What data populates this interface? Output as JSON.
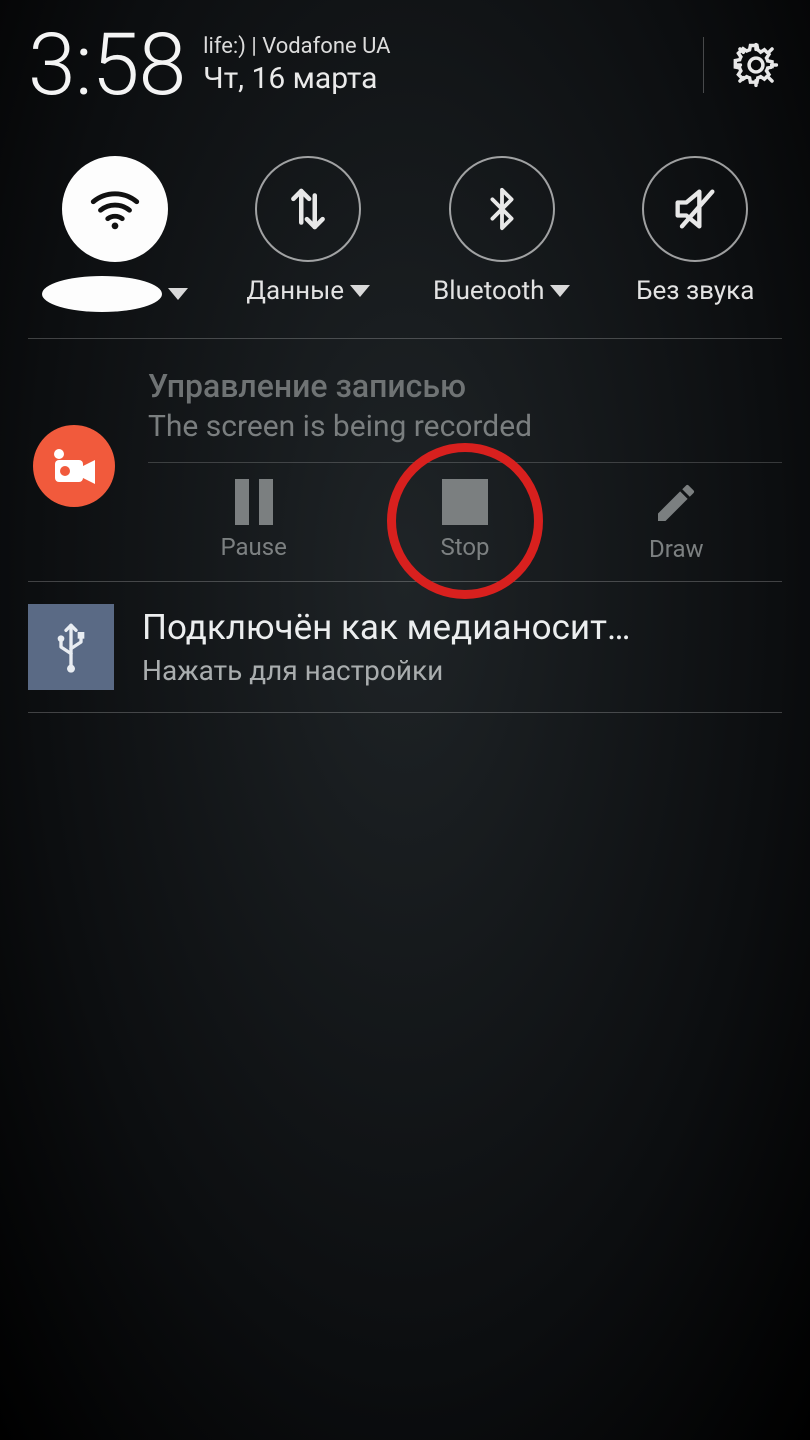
{
  "status": {
    "time": "3:58",
    "carrier": "life:) | Vodafone UA",
    "date": "Чт, 16 марта"
  },
  "quick_settings": {
    "wifi": {
      "label": ""
    },
    "data": {
      "label": "Данные"
    },
    "bluetooth": {
      "label": "Bluetooth"
    },
    "mute": {
      "label": "Без звука"
    }
  },
  "recorder": {
    "title": "Управление записью",
    "subtitle": "The screen is being recorded",
    "actions": {
      "pause": "Pause",
      "stop": "Stop",
      "draw": "Draw"
    }
  },
  "usb": {
    "title": "Подключён как медианосит…",
    "subtitle": "Нажать для настройки"
  }
}
